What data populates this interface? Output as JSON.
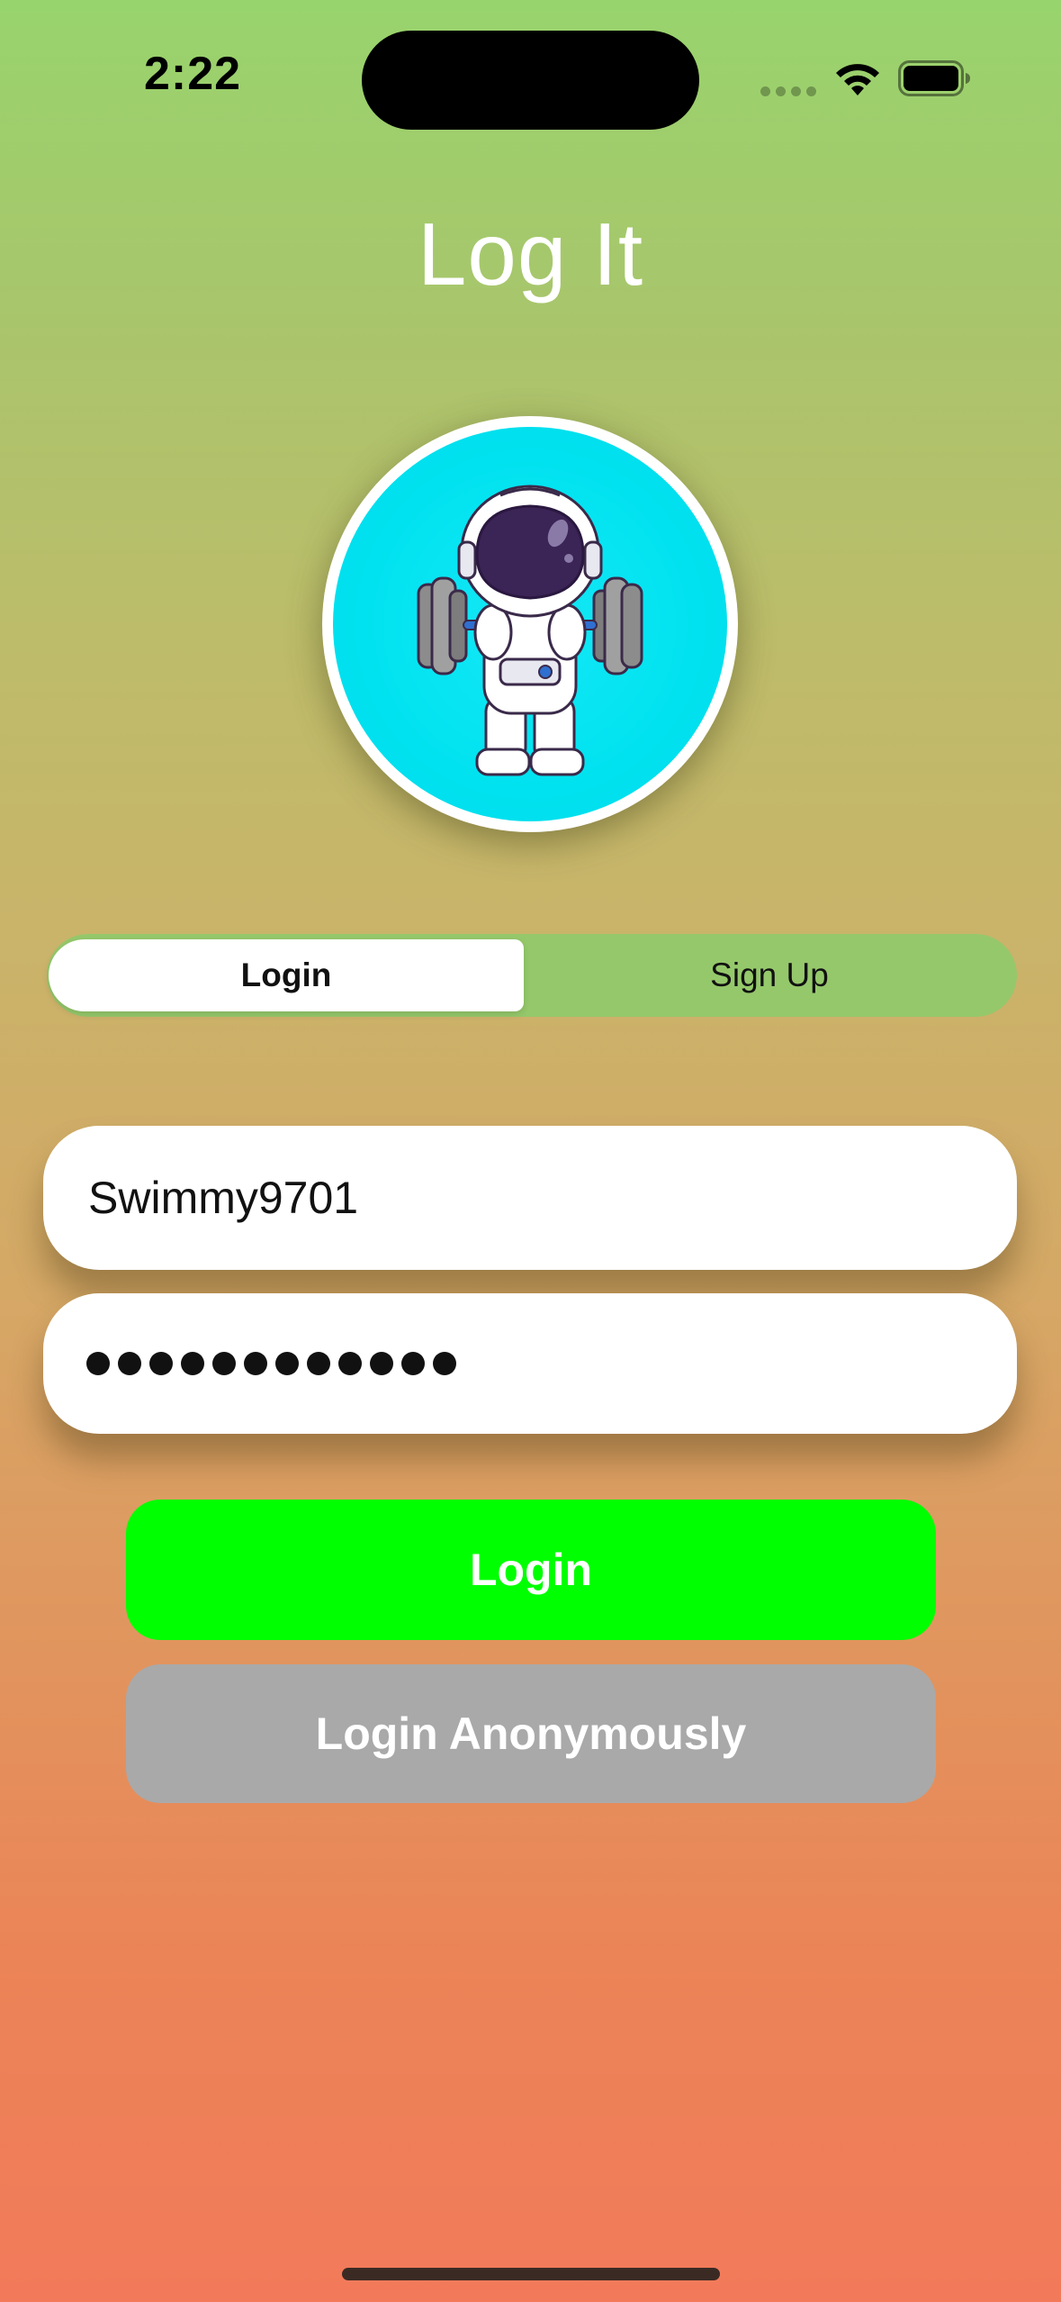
{
  "status_bar": {
    "time": "2:22",
    "icons": [
      "cellular-signal-icon",
      "wifi-icon",
      "battery-icon"
    ]
  },
  "app": {
    "title": "Log It"
  },
  "avatar": {
    "image": "astronaut-lifting-barbell",
    "background_color": "#00e2ef"
  },
  "segmented_control": {
    "options": [
      "Login",
      "Sign Up"
    ],
    "selected": "Login"
  },
  "form": {
    "username_value": "Swimmy9701",
    "password_length": 12
  },
  "buttons": {
    "login_label": "Login",
    "anonymous_label": "Login Anonymously"
  },
  "colors": {
    "gradient_top": "#98d46d",
    "gradient_bottom": "#f27a5a",
    "login_button": "#00ff00",
    "anonymous_button": "#a9a9a9",
    "segment_background": "#95c86b"
  }
}
